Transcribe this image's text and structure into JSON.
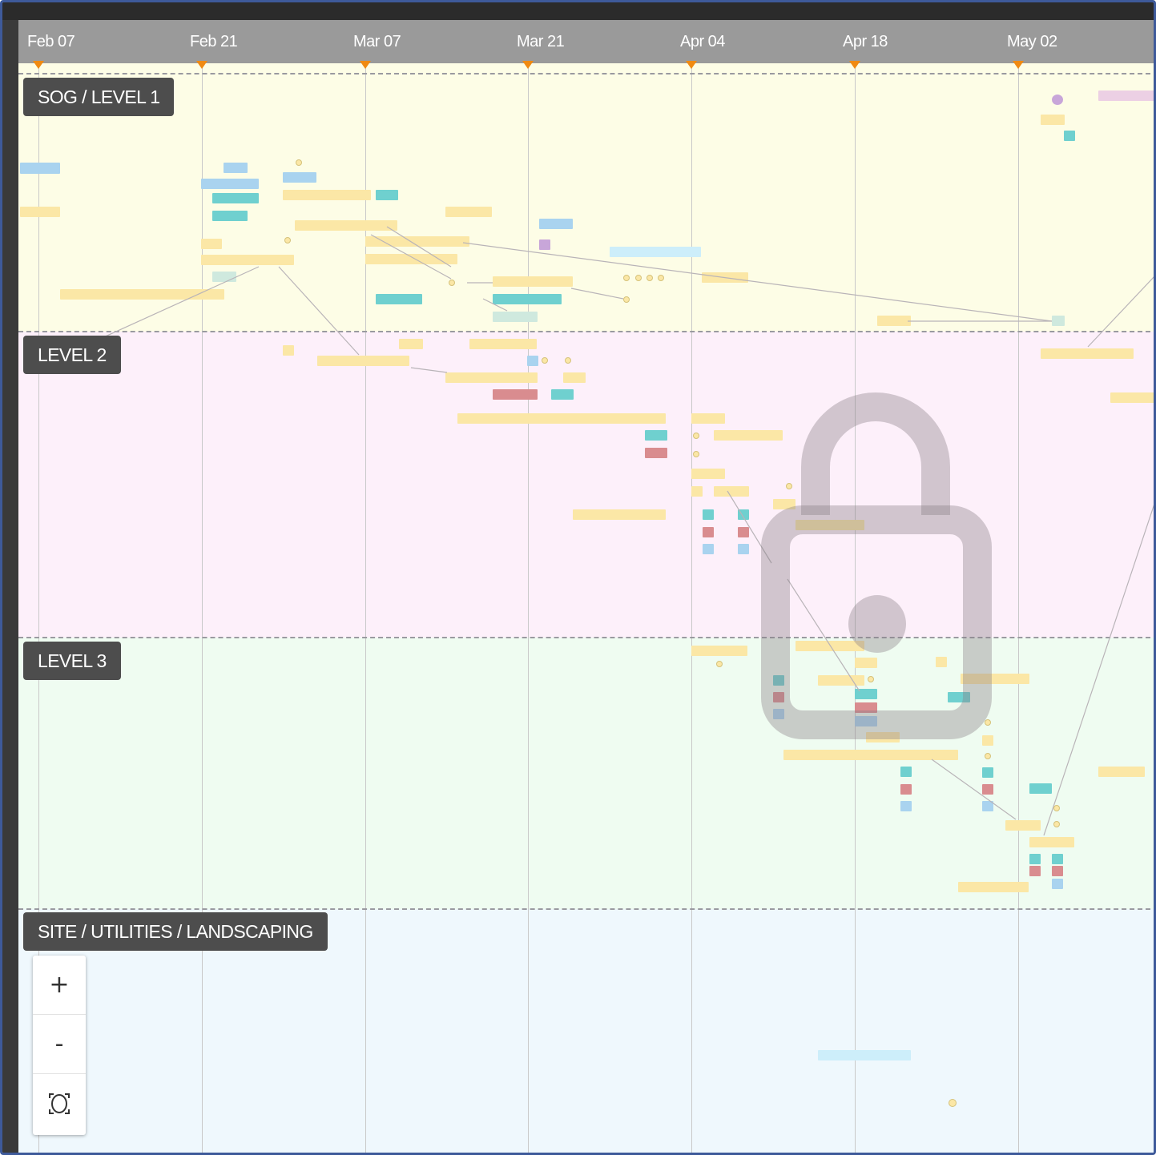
{
  "timeline": {
    "dates": [
      "Feb 07",
      "Feb 21",
      "Mar 07",
      "Mar 21",
      "Apr 04",
      "Apr 18",
      "May 02"
    ]
  },
  "lanes": [
    {
      "label": "SOG / LEVEL 1",
      "color": "#fdfde6"
    },
    {
      "label": "LEVEL 2",
      "color": "#fdf0fa"
    },
    {
      "label": "LEVEL 3",
      "color": "#effcf1"
    },
    {
      "label": "SITE / UTILITIES / LANDSCAPING",
      "color": "#eff8fd"
    }
  ],
  "zoom": {
    "zoom_in_label": "+",
    "zoom_out_label": "-"
  },
  "colors": {
    "header": "#9a9a9a",
    "marker": "#f08a12",
    "lane_tag": "#4d4d4d",
    "task_yellow": "#fbe7a6",
    "task_teal": "#6fd0cf",
    "task_blue": "#a9d3ef",
    "task_red": "#d98c8f"
  },
  "icons": {
    "lock": "lock-icon",
    "fit": "fit-to-screen-icon"
  }
}
